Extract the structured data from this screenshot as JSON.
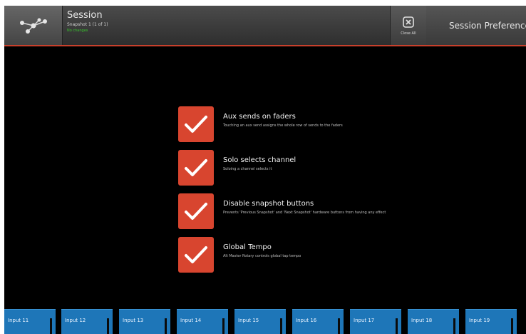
{
  "header": {
    "title": "Session",
    "subtitle": "Snapshot 1 (1 of 1)",
    "status": "No changes",
    "close_all_label": "Close All",
    "prefs_tab_label": "Session Preferences"
  },
  "colors": {
    "accent": "#d8452f",
    "input_blue": "#1e76b8",
    "status_green": "#37c12c"
  },
  "options": [
    {
      "title": "Aux sends on faders",
      "desc": "Touching an aux send assigns the whole row of sends to the faders",
      "checked": true
    },
    {
      "title": "Solo selects channel",
      "desc": "Soloing a channel selects it",
      "checked": true
    },
    {
      "title": "Disable snapshot buttons",
      "desc": "Prevents 'Previous Snapshot' and 'Next Snapshot' hardware buttons from having any effect",
      "checked": true
    },
    {
      "title": "Global Tempo",
      "desc": "Alt Master Rotary controls global tap tempo",
      "checked": true
    }
  ],
  "inputs": [
    {
      "label": "Input 11"
    },
    {
      "label": "Input 12"
    },
    {
      "label": "Input 13"
    },
    {
      "label": "Input 14"
    },
    {
      "label": "Input 15"
    },
    {
      "label": "Input 16"
    },
    {
      "label": "Input 17"
    },
    {
      "label": "Input 18"
    },
    {
      "label": "Input 19"
    }
  ],
  "icons": {
    "logo": "network-logo-icon",
    "close_all": "close-all-icon",
    "check": "checkmark-icon"
  }
}
